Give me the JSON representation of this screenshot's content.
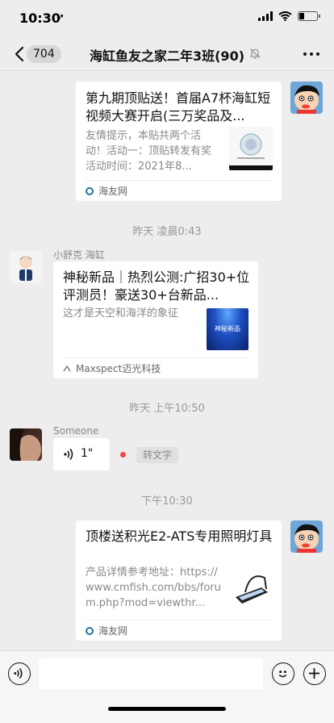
{
  "status_bar": {
    "time": "10:30",
    "location_glyph": "➚",
    "battery_level": 0.3
  },
  "nav": {
    "back_badge": "704",
    "title": "海缸鱼友之家二年3班(90)"
  },
  "messages": {
    "msg1": {
      "title": "第九期顶贴送！首届A7杯海缸短视频大赛开启(三万奖品及...",
      "desc": "友情提示，本贴共两个活动！活动一：顶贴转发有奖活动时间：2021年8...",
      "source": "海友网"
    },
    "ts1": "昨天 凌晨0:43",
    "msg2": {
      "sender": "小舒克 海缸",
      "title": "神秘新品｜热烈公测:广招30+位评测员！豪送30+台新品...",
      "desc": "这才是天空和海洋的象征",
      "thumb_text": "神秘新品",
      "source": "Maxspect迈光科技"
    },
    "ts2": "昨天 上午10:50",
    "msg3": {
      "sender": "Someone",
      "voice_duration": "1\"",
      "convert_label": "转文字"
    },
    "ts3": "下午10:30",
    "msg4": {
      "title": "顶楼送积光E2-ATS专用照明灯具",
      "desc": "产品详情参考地址：https://www.cmfish.com/bbs/forum.php?mod=viewthr...",
      "source": "海友网"
    }
  },
  "colors": {
    "background": "#ededed",
    "unread_dot": "#f04848",
    "link_blue": "#2a6f97"
  }
}
